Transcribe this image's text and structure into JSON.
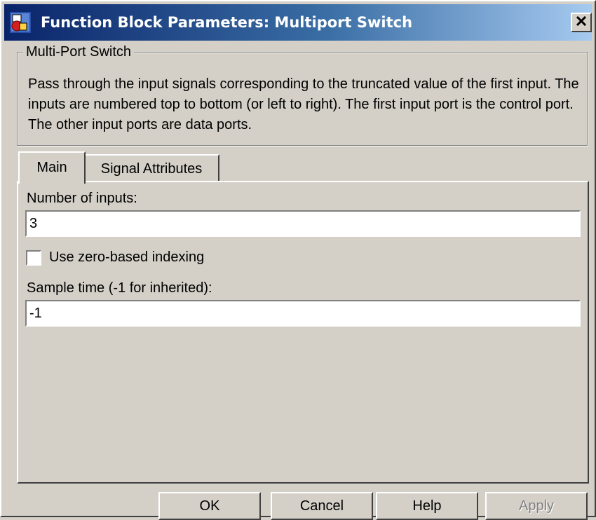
{
  "window": {
    "title": "Function Block Parameters: Multiport Switch",
    "icon": "simulink-block-icon",
    "close_icon": "close-icon"
  },
  "group": {
    "legend": "Multi-Port Switch",
    "description": "Pass through the input signals corresponding to the truncated value of the first input. The inputs are numbered top to bottom (or left to right). The first input port is the control port. The other input ports are data ports."
  },
  "tabs": [
    {
      "label": "Main",
      "active": true
    },
    {
      "label": "Signal Attributes",
      "active": false
    }
  ],
  "main": {
    "num_inputs_label": "Number of inputs:",
    "num_inputs_value": "3",
    "zero_based_label": "Use zero-based indexing",
    "zero_based_checked": false,
    "sample_time_label": "Sample time (-1 for inherited):",
    "sample_time_value": "-1"
  },
  "buttons": {
    "ok": "OK",
    "cancel": "Cancel",
    "help": "Help",
    "apply": "Apply",
    "apply_enabled": false
  },
  "colors": {
    "face": "#d4d0c8",
    "titlebar_start": "#0a246a",
    "titlebar_end": "#a6caf0"
  }
}
